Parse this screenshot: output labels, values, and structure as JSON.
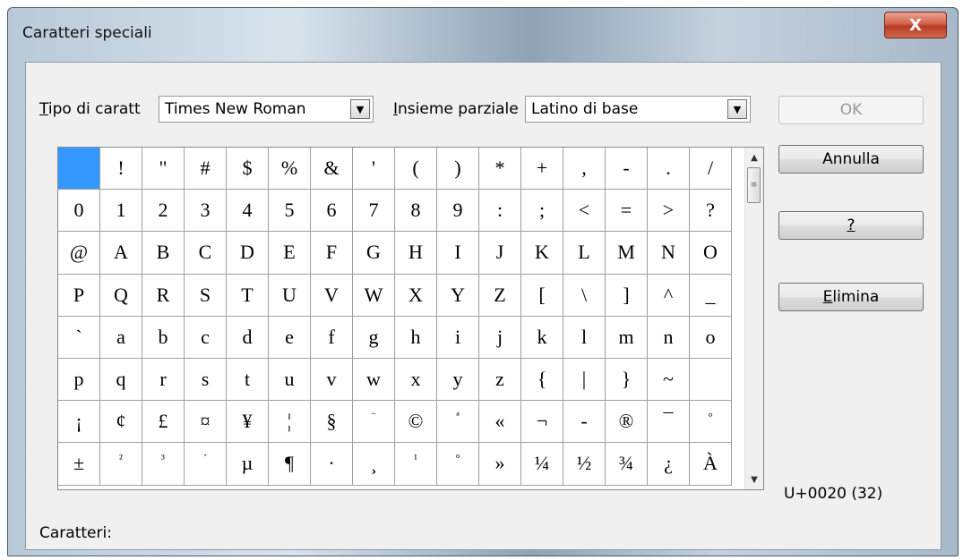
{
  "window": {
    "title": "Caratteri speciali",
    "close_glyph": "X"
  },
  "controls": {
    "font_label_mnemonic": "T",
    "font_label_rest": "ipo di caratt",
    "font_value": "Times New Roman",
    "subset_label_mnemonic": "I",
    "subset_label_rest": "nsieme parziale",
    "subset_value": "Latino di base",
    "dropdown_icon": "arrow-down-icon"
  },
  "buttons": {
    "ok": "OK",
    "cancel": "Annulla",
    "help": "?",
    "delete_mnemonic": "E",
    "delete_rest": "limina"
  },
  "charmap": {
    "selected_index": 0,
    "rows": [
      [
        " ",
        "!",
        "\"",
        "#",
        "$",
        "%",
        "&",
        "'",
        "(",
        ")",
        "*",
        "+",
        ",",
        "-",
        ".",
        "/"
      ],
      [
        "0",
        "1",
        "2",
        "3",
        "4",
        "5",
        "6",
        "7",
        "8",
        "9",
        ":",
        ";",
        "<",
        "=",
        ">",
        "?"
      ],
      [
        "@",
        "A",
        "B",
        "C",
        "D",
        "E",
        "F",
        "G",
        "H",
        "I",
        "J",
        "K",
        "L",
        "M",
        "N",
        "O"
      ],
      [
        "P",
        "Q",
        "R",
        "S",
        "T",
        "U",
        "V",
        "W",
        "X",
        "Y",
        "Z",
        "[",
        "\\",
        "]",
        "^",
        "_"
      ],
      [
        "`",
        "a",
        "b",
        "c",
        "d",
        "e",
        "f",
        "g",
        "h",
        "i",
        "j",
        "k",
        "l",
        "m",
        "n",
        "o"
      ],
      [
        "p",
        "q",
        "r",
        "s",
        "t",
        "u",
        "v",
        "w",
        "x",
        "y",
        "z",
        "{",
        "|",
        "}",
        "~",
        ""
      ],
      [
        "¡",
        "¢",
        "£",
        "¤",
        "¥",
        "¦",
        "§",
        "¨",
        "©",
        "ª",
        "«",
        "¬",
        "-",
        "®",
        "¯",
        "°"
      ],
      [
        "±",
        "²",
        "³",
        "´",
        "µ",
        "¶",
        "·",
        "¸",
        "¹",
        "º",
        "»",
        "¼",
        "½",
        "¾",
        "¿",
        "À"
      ]
    ],
    "small_glyphs": [
      "²",
      "³",
      "¹",
      "º",
      "ª",
      "°",
      "´",
      "¨"
    ]
  },
  "status": {
    "code": "U+0020 (32)",
    "characters_label": "Caratteri:"
  }
}
